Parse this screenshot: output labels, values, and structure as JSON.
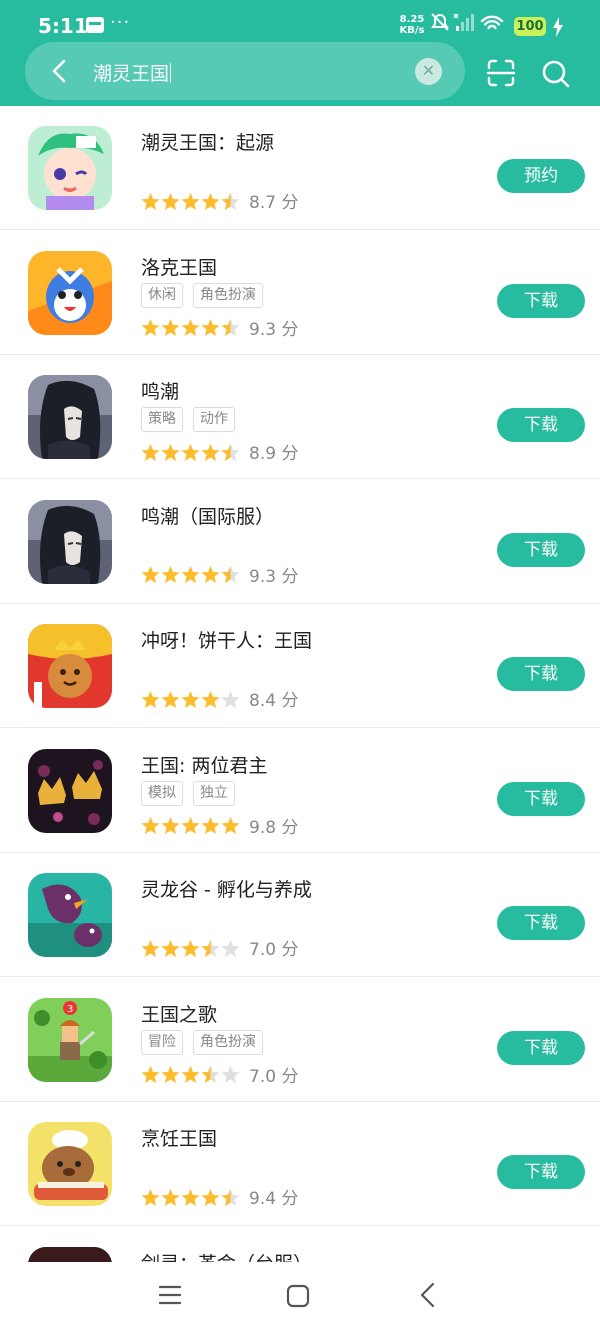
{
  "status_bar": {
    "time": "5:11",
    "more": "···",
    "net_speed_value": "8.25",
    "net_speed_unit": "KB/s",
    "battery": "100"
  },
  "search": {
    "query": "潮灵王国"
  },
  "apps": [
    {
      "title": "潮灵王国：起源",
      "tags": [],
      "rating": 4.5,
      "score": "8.7 分",
      "action": "预约",
      "icon": "chaoling-icon",
      "top": 0
    },
    {
      "title": "洛克王国",
      "tags": [
        "休闲",
        "角色扮演"
      ],
      "rating": 4.5,
      "score": "9.3 分",
      "action": "下载",
      "icon": "roco-icon"
    },
    {
      "title": "鸣潮",
      "tags": [
        "策略",
        "动作"
      ],
      "rating": 4.5,
      "score": "8.9 分",
      "action": "下载",
      "icon": "wuthering-icon"
    },
    {
      "title": "鸣潮（国际服）",
      "tags": [],
      "rating": 4.5,
      "score": "9.3 分",
      "action": "下载",
      "icon": "wuthering-global-icon"
    },
    {
      "title": "冲呀！饼干人：王国",
      "tags": [],
      "rating": 4,
      "score": "8.4 分",
      "action": "下载",
      "icon": "cookie-icon"
    },
    {
      "title": "王国: 两位君主",
      "tags": [
        "模拟",
        "独立"
      ],
      "rating": 5,
      "score": "9.8 分",
      "action": "下载",
      "icon": "crown-icon"
    },
    {
      "title": "灵龙谷 - 孵化与养成",
      "tags": [],
      "rating": 3.5,
      "score": "7.0 分",
      "action": "下载",
      "icon": "dragon-icon"
    },
    {
      "title": "王国之歌",
      "tags": [
        "冒险",
        "角色扮演"
      ],
      "rating": 3.5,
      "score": "7.0 分",
      "action": "下载",
      "icon": "knight-icon"
    },
    {
      "title": "烹饪王国",
      "tags": [],
      "rating": 4.5,
      "score": "9.4 分",
      "action": "下载",
      "icon": "cooking-icon"
    },
    {
      "title": "剑灵：革命（台服）",
      "tags": [],
      "rating": 0,
      "score": "",
      "action": "",
      "icon": "blade-icon"
    }
  ]
}
